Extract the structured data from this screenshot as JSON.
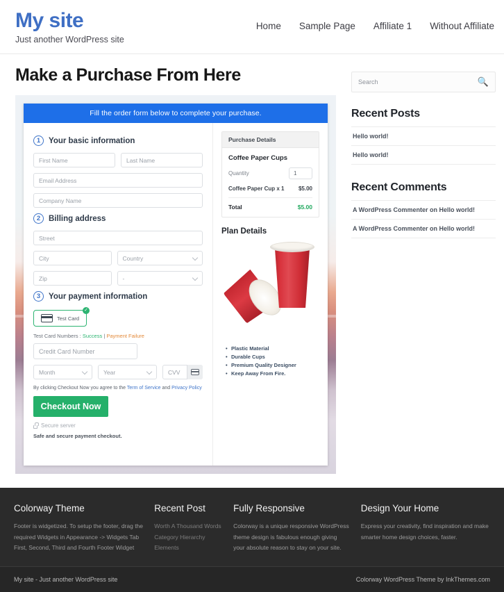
{
  "header": {
    "site_title": "My site",
    "tagline": "Just another WordPress site",
    "nav": [
      {
        "label": "Home"
      },
      {
        "label": "Sample Page"
      },
      {
        "label": "Affiliate 1"
      },
      {
        "label": "Without Affiliate"
      }
    ]
  },
  "main": {
    "page_title": "Make a Purchase From Here",
    "order_form": {
      "banner": "Fill the order form below to complete your purchase.",
      "steps": [
        {
          "number": "1",
          "label": "Your basic information"
        },
        {
          "number": "2",
          "label": "Billing address"
        },
        {
          "number": "3",
          "label": "Your payment information"
        }
      ],
      "fields": {
        "first_name": "First Name",
        "last_name": "Last Name",
        "email": "Email Address",
        "company": "Company Name",
        "street": "Street",
        "city": "City",
        "country": "Country",
        "zip": "Zip",
        "state": "-",
        "credit_card": "Credit Card Number",
        "month": "Month",
        "year": "Year",
        "cvv": "CVV"
      },
      "payment": {
        "test_card_chip": "Test  Card",
        "chip_check_icon": "check-icon",
        "card_icon": "credit-card-icon",
        "test_numbers_prefix": "Test Card Numbers :",
        "test_numbers_success": "Success",
        "test_numbers_separator": "|",
        "test_numbers_failure": "Payment Failure",
        "agree_prefix": "By clicking Checkout Now you agree to the",
        "agree_terms": "Term of Service",
        "agree_and": "and",
        "agree_privacy": "Privacy Policy",
        "checkout_button": "Checkout Now",
        "secure_server": "Secure server",
        "lock_icon": "lock-icon",
        "safe_note": "Safe and secure payment checkout."
      }
    },
    "purchase_details": {
      "heading": "Purchase Details",
      "product": "Coffee Paper Cups",
      "quantity_label": "Quantity",
      "quantity_value": "1",
      "line_item_label": "Coffee Paper Cup x 1",
      "line_item_amount": "$5.00",
      "total_label": "Total",
      "total_amount": "$5.00"
    },
    "plan_details": {
      "heading": "Plan Details",
      "image_alt": "coffee-paper-cups-image",
      "features": [
        "Plastic Material",
        "Durable Cups",
        "Premium Quality Designer",
        "Keep Away From Fire."
      ]
    }
  },
  "sidebar": {
    "search_placeholder": "Search",
    "search_icon": "search-icon",
    "recent_posts": {
      "title": "Recent Posts",
      "items": [
        "Hello world!",
        "Hello world!"
      ]
    },
    "recent_comments": {
      "title": "Recent Comments",
      "items": [
        "A WordPress Commenter on Hello world!",
        "A WordPress Commenter on Hello world!"
      ]
    }
  },
  "footer": {
    "columns": [
      {
        "title": "Colorway Theme",
        "text": "Footer is widgetized. To setup the footer, drag the required Widgets in Appearance -> Widgets Tab First, Second, Third and Fourth Footer Widget"
      },
      {
        "title": "Recent Post",
        "items": [
          "Worth A Thousand Words",
          "Category Hierarchy",
          "Elements"
        ]
      },
      {
        "title": "Fully Responsive",
        "text": "Colorway is a unique responsive WordPress theme design is fabulous enough giving your absolute reason to stay on your site."
      },
      {
        "title": "Design Your Home",
        "text": "Express your creativity, find inspiration and make smarter home design choices, faster."
      }
    ],
    "copyright_left": "My site - Just another WordPress site",
    "copyright_right": "Colorway WordPress Theme by InkThemes.com"
  },
  "colors": {
    "brand_blue": "#3F6FC4",
    "banner_blue": "#1E6FE8",
    "checkout_green": "#25B06A",
    "success_green": "#2DB472",
    "failure_orange": "#E38A3A",
    "total_green": "#22A95F",
    "footer_bg": "#2b2b2b"
  }
}
